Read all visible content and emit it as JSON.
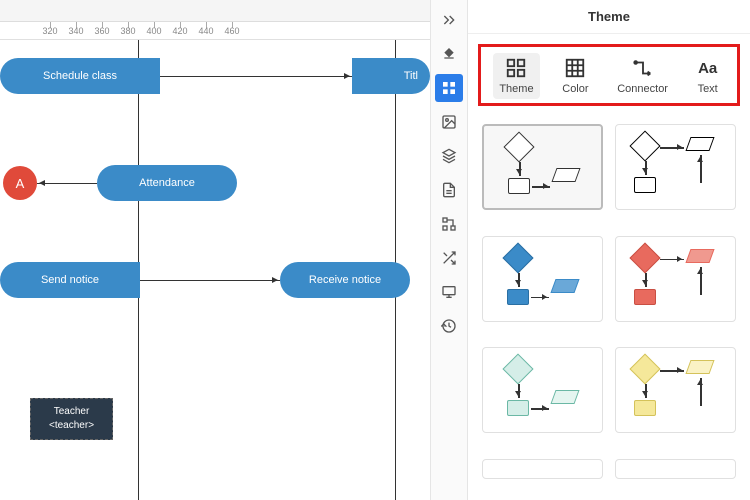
{
  "panel": {
    "title": "Theme"
  },
  "tabs": {
    "theme": "Theme",
    "color": "Color",
    "connector": "Connector",
    "text": "Text"
  },
  "ruler": {
    "ticks": [
      320,
      340,
      360,
      380,
      400,
      420,
      440,
      460
    ]
  },
  "nodes": {
    "schedule": "Schedule class",
    "title_partial": "Titl",
    "attendance": "Attendance",
    "a_circle": "A",
    "send": "Send notice",
    "receive": "Receive notice",
    "teacher_line1": "Teacher",
    "teacher_line2": "<teacher>"
  },
  "themes": [
    {
      "diamond_fill": "#fff",
      "diamond_stroke": "#333",
      "rect_fill": "#fff",
      "rect_stroke": "#333",
      "para_fill": "#fff",
      "para_stroke": "#333",
      "selected": true,
      "variant": "a"
    },
    {
      "diamond_fill": "#fff",
      "diamond_stroke": "#000",
      "rect_fill": "#fff",
      "rect_stroke": "#000",
      "para_fill": "#fff",
      "para_stroke": "#000",
      "selected": false,
      "variant": "b"
    },
    {
      "diamond_fill": "#3b8bc8",
      "diamond_stroke": "#2a6fa3",
      "rect_fill": "#3b8bc8",
      "rect_stroke": "#2a6fa3",
      "para_fill": "#6aa8d8",
      "para_stroke": "#3b8bc8",
      "selected": false,
      "variant": "a"
    },
    {
      "diamond_fill": "#e86a5e",
      "diamond_stroke": "#c94f43",
      "rect_fill": "#e86a5e",
      "rect_stroke": "#c94f43",
      "para_fill": "#f0998f",
      "para_stroke": "#e86a5e",
      "selected": false,
      "variant": "b"
    },
    {
      "diamond_fill": "#d5eee8",
      "diamond_stroke": "#6bb8a5",
      "rect_fill": "#d5eee8",
      "rect_stroke": "#6bb8a5",
      "para_fill": "#e5f5f0",
      "para_stroke": "#6bb8a5",
      "selected": false,
      "variant": "a"
    },
    {
      "diamond_fill": "#f5e89a",
      "diamond_stroke": "#d4c25a",
      "rect_fill": "#f5e89a",
      "rect_stroke": "#d4c25a",
      "para_fill": "#faf2c5",
      "para_stroke": "#d4c25a",
      "selected": false,
      "variant": "b"
    }
  ]
}
